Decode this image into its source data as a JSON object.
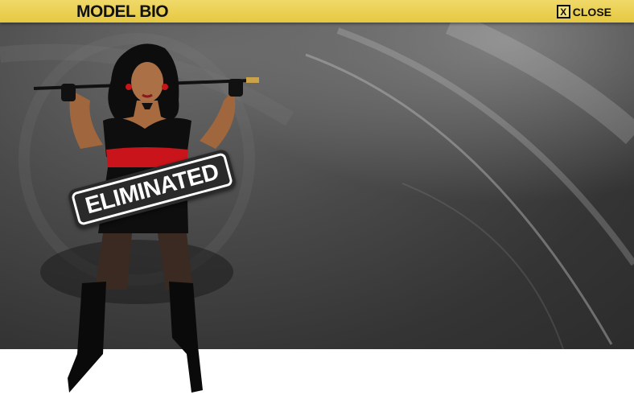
{
  "header": {
    "title": "MODEL BIO",
    "close_icon_glyph": "X",
    "close_label": "CLOSE"
  },
  "model": {
    "status_stamp": "ELIMINATED"
  },
  "colors": {
    "header_bar": "#e8cc48",
    "stage_background": "#3f3f3f",
    "accent_red": "#c8141a"
  }
}
